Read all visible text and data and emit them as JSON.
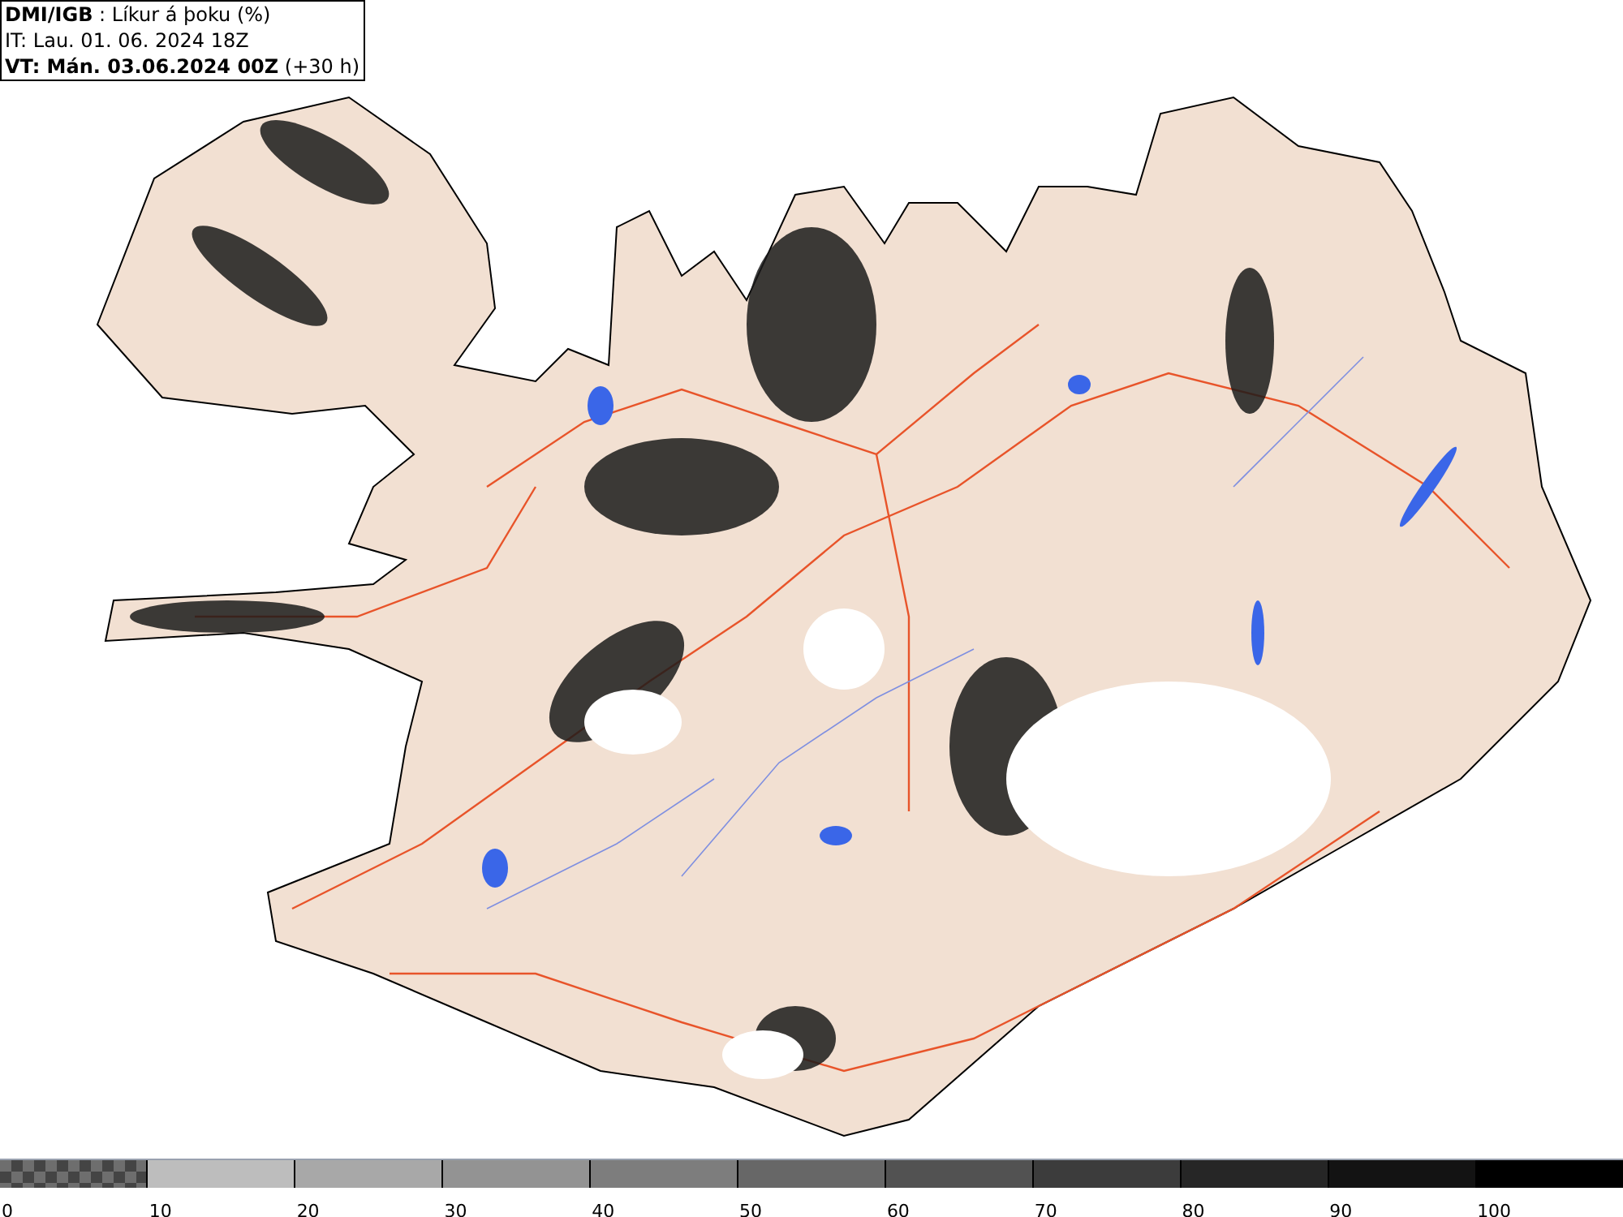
{
  "header": {
    "lines": [
      "**DMI/IGB** : Líkur á þoku (%)",
      "IT: Lau. 01. 06. 2024 18Z",
      "**VT: Mán. 03.06.2024 00Z** (+30 h)"
    ]
  },
  "legend": {
    "swatches": [
      {
        "kind": "checker",
        "color": "#6e6e6e"
      },
      {
        "kind": "solid",
        "color": "#bdbdbd"
      },
      {
        "kind": "solid",
        "color": "#a8a8a8"
      },
      {
        "kind": "solid",
        "color": "#939393"
      },
      {
        "kind": "solid",
        "color": "#7d7d7d"
      },
      {
        "kind": "solid",
        "color": "#676767"
      },
      {
        "kind": "solid",
        "color": "#525252"
      },
      {
        "kind": "solid",
        "color": "#3c3c3c"
      },
      {
        "kind": "solid",
        "color": "#262626"
      },
      {
        "kind": "solid",
        "color": "#131313"
      },
      {
        "kind": "solid",
        "color": "#000000"
      }
    ],
    "labels": [
      "0",
      "10",
      "20",
      "30",
      "40",
      "50",
      "60",
      "70",
      "80",
      "90",
      "100"
    ]
  }
}
